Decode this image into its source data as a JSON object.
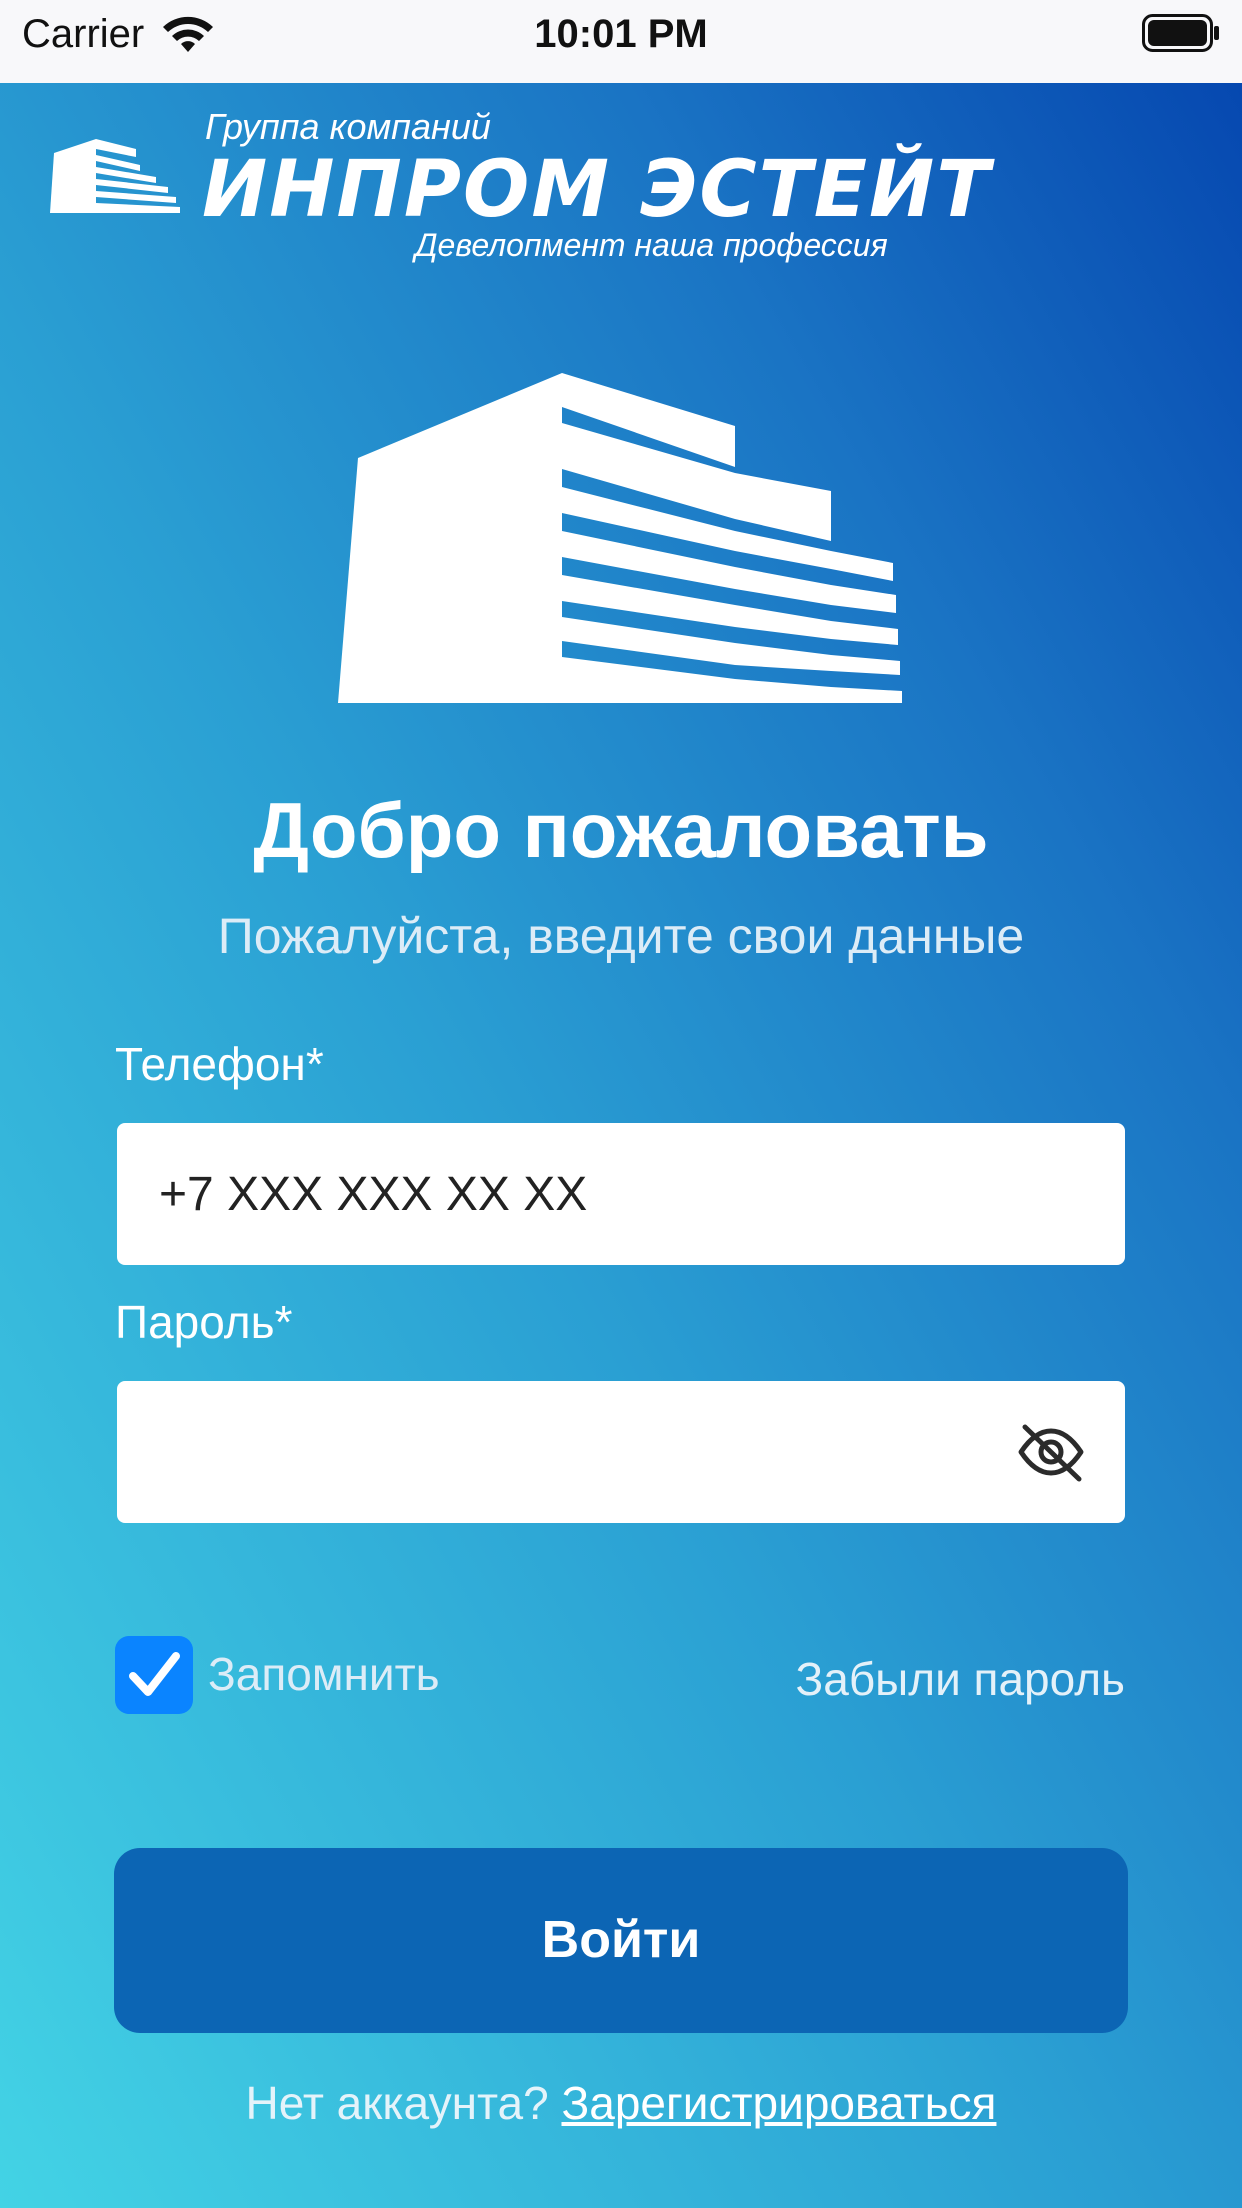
{
  "status_bar": {
    "carrier": "Carrier",
    "time": "10:01 PM",
    "wifi_icon": "wifi-icon",
    "battery_icon": "battery-icon"
  },
  "logo": {
    "group": "Группа компаний",
    "name": "ИНПРОМ ЭСТЕЙТ",
    "slogan": "Девелопмент наша профессия",
    "icon": "building-logo-icon"
  },
  "hero": {
    "icon": "building-icon"
  },
  "welcome": {
    "title": "Добро пожаловать",
    "subtitle": "Пожалуйста, введите свои данные"
  },
  "form": {
    "phone_label": "Телефон*",
    "phone_placeholder": "+7 XXX XXX XX XX",
    "phone_value": "",
    "password_label": "Пароль*",
    "password_value": "",
    "password_toggle_icon": "eye-slash-icon",
    "remember_label": "Запомнить",
    "remember_checked": true,
    "forgot_label": "Забыли пароль",
    "login_label": "Войти"
  },
  "signup": {
    "prompt": "Нет аккаунта?",
    "link": "Зарегистрироваться"
  },
  "colors": {
    "gradient_start": "#43d3e5",
    "gradient_end": "#0648b0",
    "button": "#0c65b4",
    "checkbox": "#0a84ff"
  }
}
